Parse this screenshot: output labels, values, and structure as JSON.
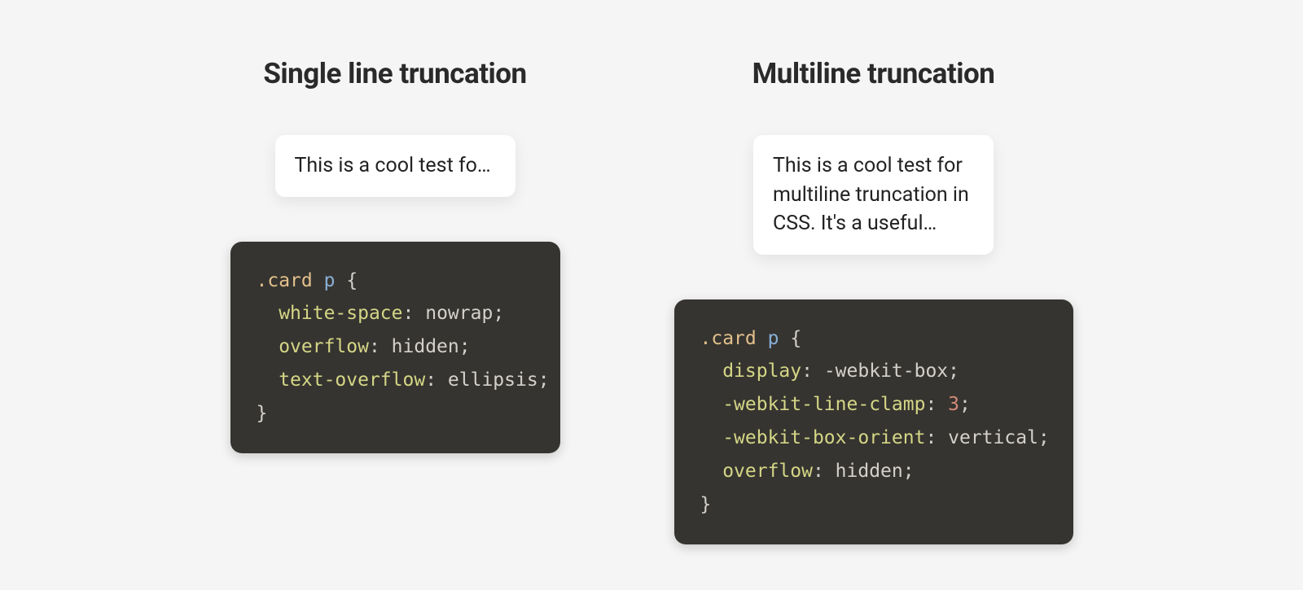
{
  "left": {
    "heading": "Single line truncation",
    "card_text": "This is a cool test for single line truncation in CSS.",
    "code": {
      "selector_class": ".card",
      "selector_el": "p",
      "brace_open": "{",
      "brace_close": "}",
      "lines": [
        {
          "prop": "white-space",
          "val": "nowrap"
        },
        {
          "prop": "overflow",
          "val": "hidden"
        },
        {
          "prop": "text-overflow",
          "val": "ellipsis"
        }
      ]
    }
  },
  "right": {
    "heading": "Multiline truncation",
    "card_text": "This is a cool test for multiline truncation in CSS. It's a useful technique to know about.",
    "code": {
      "selector_class": ".card",
      "selector_el": "p",
      "brace_open": "{",
      "brace_close": "}",
      "lines": [
        {
          "prop": "display",
          "val": "-webkit-box"
        },
        {
          "prop": "-webkit-line-clamp",
          "num": "3"
        },
        {
          "prop": "-webkit-box-orient",
          "val": "vertical"
        },
        {
          "prop": "overflow",
          "val": "hidden"
        }
      ]
    }
  }
}
